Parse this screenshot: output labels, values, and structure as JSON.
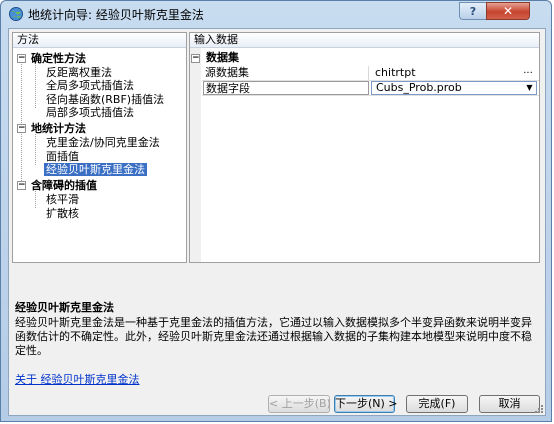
{
  "window": {
    "title": "地统计向导: 经验贝叶斯克里金法",
    "help_button": "?",
    "close_button": "✕"
  },
  "methods_panel": {
    "header": "方法",
    "groups": [
      {
        "label": "确定性方法",
        "expander": "−",
        "items": [
          "反距离权重法",
          "全局多项式插值法",
          "径向基函数(RBF)插值法",
          "局部多项式插值法"
        ]
      },
      {
        "label": "地统计方法",
        "expander": "−",
        "items": [
          "克里金法/协同克里金法",
          "面插值",
          "经验贝叶斯克里金法"
        ]
      },
      {
        "label": "含障碍的插值",
        "expander": "−",
        "items": [
          "核平滑",
          "扩散核"
        ]
      }
    ],
    "selected_item": "经验贝叶斯克里金法"
  },
  "input_panel": {
    "header": "输入数据",
    "category": {
      "label": "数据集",
      "expander": "−"
    },
    "rows": [
      {
        "name": "源数据集",
        "value": "chitrtpt",
        "button": "..."
      },
      {
        "name": "数据字段",
        "value": "Cubs_Prob.prob",
        "dropdown_arrow": "▼"
      }
    ]
  },
  "description": {
    "title": "经验贝叶斯克里金法",
    "text": "经验贝叶斯克里金法是一种基于克里金法的插值方法，它通过以输入数据模拟多个半变异函数来说明半变异函数估计的不确定性。此外，经验贝叶斯克里金法还通过根据输入数据的子集构建本地模型来说明中度不稳定性。",
    "link": "关于 经验贝叶斯克里金法"
  },
  "buttons": {
    "back": "< 上一步(B)",
    "next": "下一步(N) >",
    "finish": "完成(F)",
    "cancel": "取消"
  },
  "colors": {
    "selection": "#3a6fc4",
    "link": "#0033cc",
    "close_button": "#c6452f",
    "frame": "#b4cce6"
  }
}
